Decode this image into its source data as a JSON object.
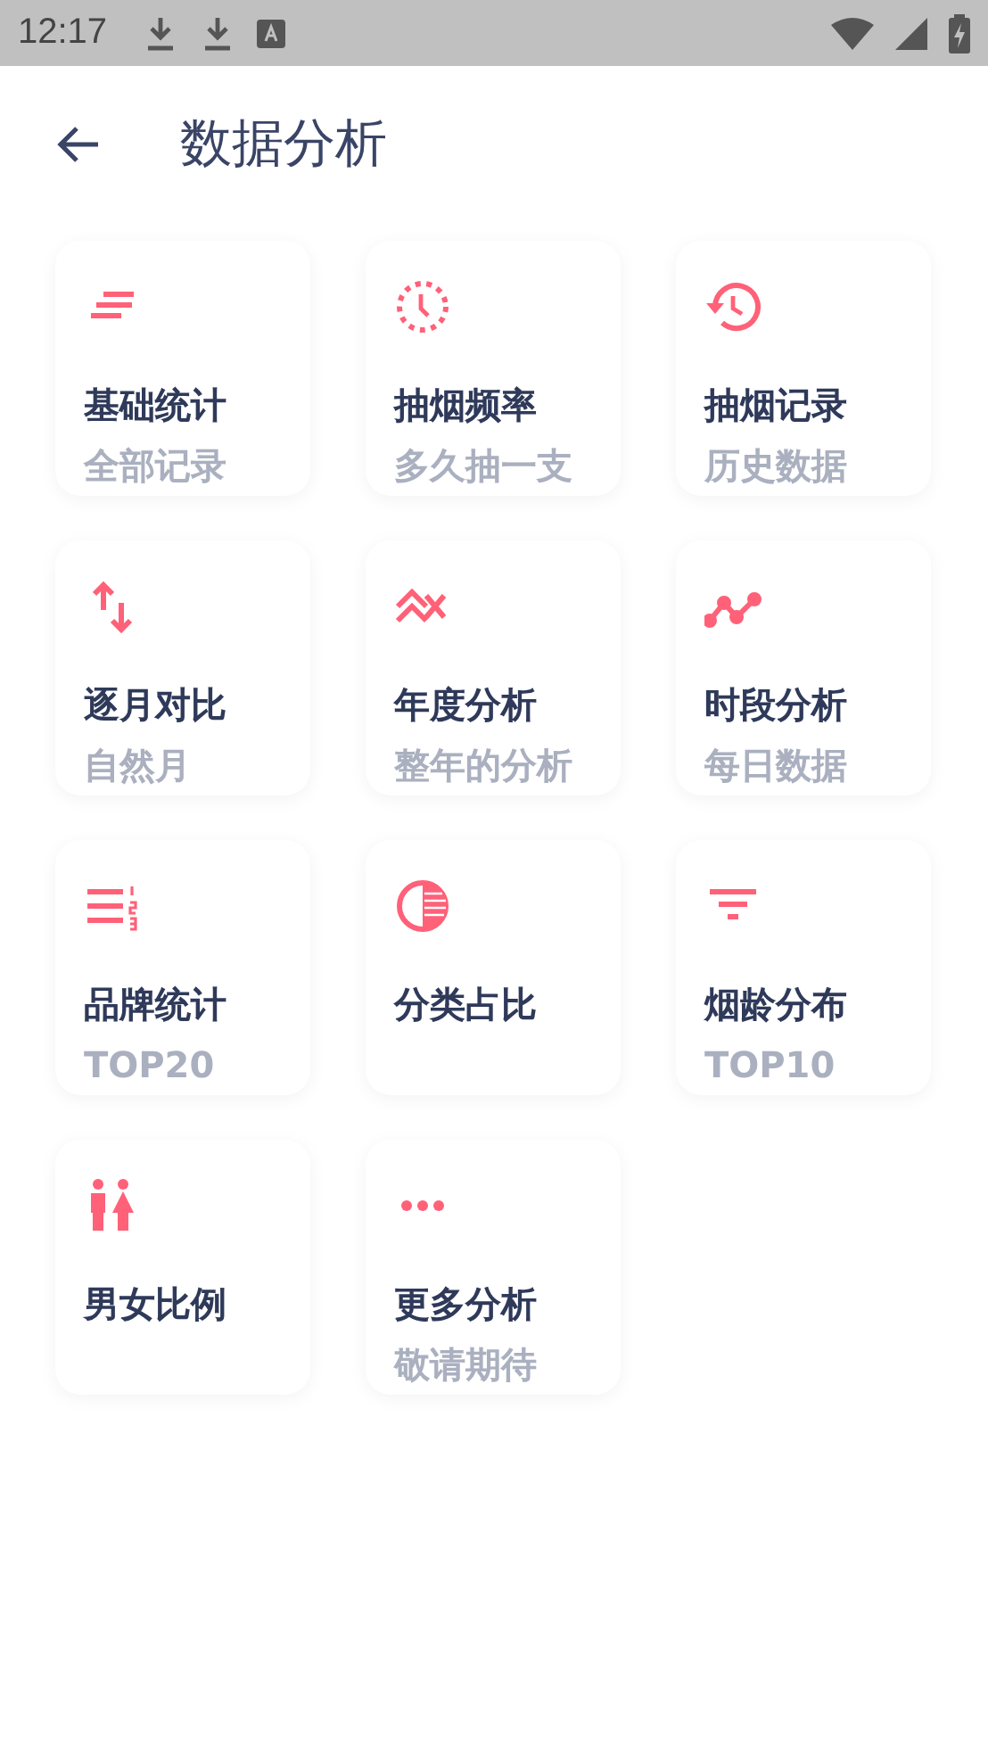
{
  "status_bar": {
    "time": "12:17"
  },
  "header": {
    "title": "数据分析"
  },
  "cards": [
    {
      "title": "基础统计",
      "subtitle": "全部记录"
    },
    {
      "title": "抽烟频率",
      "subtitle": "多久抽一支"
    },
    {
      "title": "抽烟记录",
      "subtitle": "历史数据"
    },
    {
      "title": "逐月对比",
      "subtitle": "自然月"
    },
    {
      "title": "年度分析",
      "subtitle": "整年的分析"
    },
    {
      "title": "时段分析",
      "subtitle": "每日数据"
    },
    {
      "title": "品牌统计",
      "subtitle": "TOP20"
    },
    {
      "title": "分类占比"
    },
    {
      "title": "烟龄分布",
      "subtitle": "TOP10"
    },
    {
      "title": "男女比例"
    },
    {
      "title": "更多分析",
      "subtitle": "敬请期待"
    }
  ]
}
